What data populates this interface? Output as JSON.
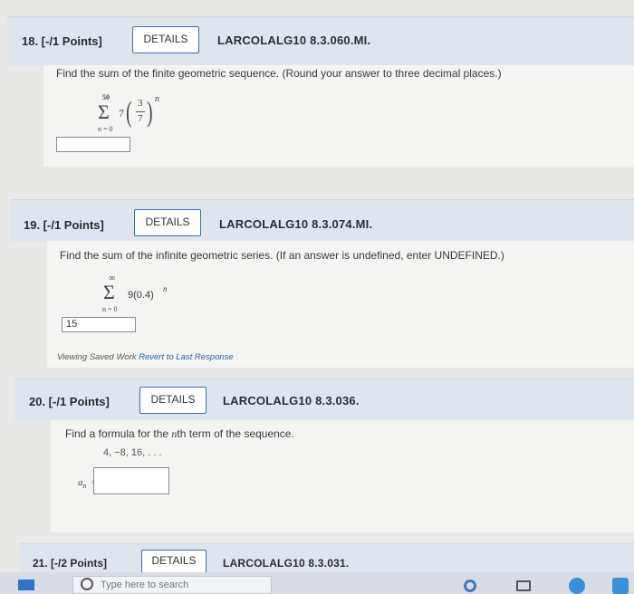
{
  "q18": {
    "label": "18. [-/1 Points]",
    "details": "DETAILS",
    "code": "LARCOLALG10 8.3.060.MI.",
    "prompt": "Find the sum of the finite geometric sequence. (Round your answer to three decimal places.)",
    "sum_upper": "50",
    "sum_lower": "n = 0",
    "coef": "7",
    "frac_num": "3",
    "frac_den": "7",
    "exponent": "n",
    "answer": ""
  },
  "q19": {
    "label": "19. [-/1 Points]",
    "details": "DETAILS",
    "code": "LARCOLALG10 8.3.074.MI.",
    "prompt": "Find the sum of the infinite geometric series. (If an answer is undefined, enter UNDEFINED.)",
    "sum_upper": "∞",
    "sum_lower": "n = 0",
    "term": "9(0.4)",
    "exponent": "n",
    "answer": "15",
    "note_prefix": "Viewing Saved Work",
    "note_link": "Revert to Last Response"
  },
  "q20": {
    "label": "20. [-/1 Points]",
    "details": "DETAILS",
    "code": "LARCOLALG10 8.3.036.",
    "prompt_a": "Find a formula for the",
    "prompt_n": "n",
    "prompt_b": "th term of the sequence.",
    "sequence": "4, −8, 16, . . .",
    "an_label": "a",
    "an_sub": "n",
    "equals": "=",
    "answer": ""
  },
  "q21": {
    "label": "21. [-/2 Points]",
    "details": "DETAILS",
    "code": "LARCOLALG10 8.3.031."
  },
  "taskbar": {
    "search_placeholder": "Type here to search"
  }
}
